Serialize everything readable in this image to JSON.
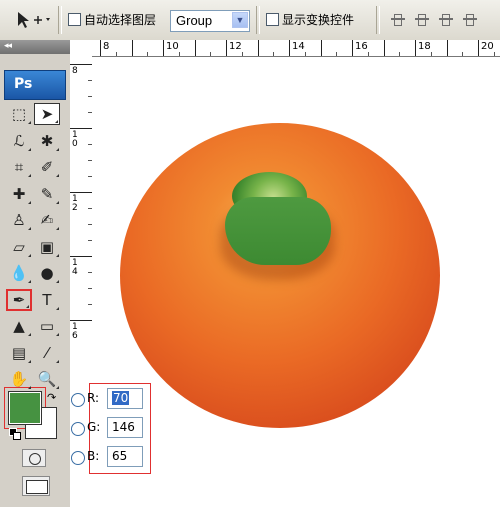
{
  "options_bar": {
    "auto_select_label": "自动选择图层",
    "auto_select_value": "Group",
    "show_transform_label": "显示变换控件"
  },
  "toolbox": {
    "logo": "Ps",
    "collapse_glyph": "◂◂",
    "tools": [
      {
        "name": "marquee-tool",
        "glyph": "⬚"
      },
      {
        "name": "move-tool",
        "glyph": "➤"
      },
      {
        "name": "lasso-tool",
        "glyph": "ℒ"
      },
      {
        "name": "magic-wand-tool",
        "glyph": "✱"
      },
      {
        "name": "crop-tool",
        "glyph": "⌗"
      },
      {
        "name": "slice-tool",
        "glyph": "✐"
      },
      {
        "name": "healing-brush-tool",
        "glyph": "✚"
      },
      {
        "name": "brush-tool",
        "glyph": "✎"
      },
      {
        "name": "clone-stamp-tool",
        "glyph": "♙"
      },
      {
        "name": "history-brush-tool",
        "glyph": "✍"
      },
      {
        "name": "eraser-tool",
        "glyph": "▱"
      },
      {
        "name": "gradient-tool",
        "glyph": "▣"
      },
      {
        "name": "blur-tool",
        "glyph": "💧"
      },
      {
        "name": "dodge-tool",
        "glyph": "●"
      },
      {
        "name": "pen-tool",
        "glyph": "✒"
      },
      {
        "name": "type-tool",
        "glyph": "T"
      },
      {
        "name": "path-selection-tool",
        "glyph": "▲"
      },
      {
        "name": "shape-tool",
        "glyph": "▭"
      },
      {
        "name": "notes-tool",
        "glyph": "▤"
      },
      {
        "name": "eyedropper-tool",
        "glyph": "⁄"
      },
      {
        "name": "hand-tool",
        "glyph": "✋"
      },
      {
        "name": "zoom-tool",
        "glyph": "🔍"
      }
    ],
    "foreground_color": "#469241",
    "background_color": "#ffffff"
  },
  "ruler": {
    "h_labels": [
      "8",
      "10",
      "12",
      "14",
      "16",
      "18",
      "20"
    ],
    "v_labels": [
      "8",
      "1\n0",
      "1\n2",
      "1\n4",
      "1\n6"
    ]
  },
  "color_picker": {
    "r_label": "R:",
    "r_value": "70",
    "g_label": "G:",
    "g_value": "146",
    "b_label": "B:",
    "b_value": "65"
  }
}
